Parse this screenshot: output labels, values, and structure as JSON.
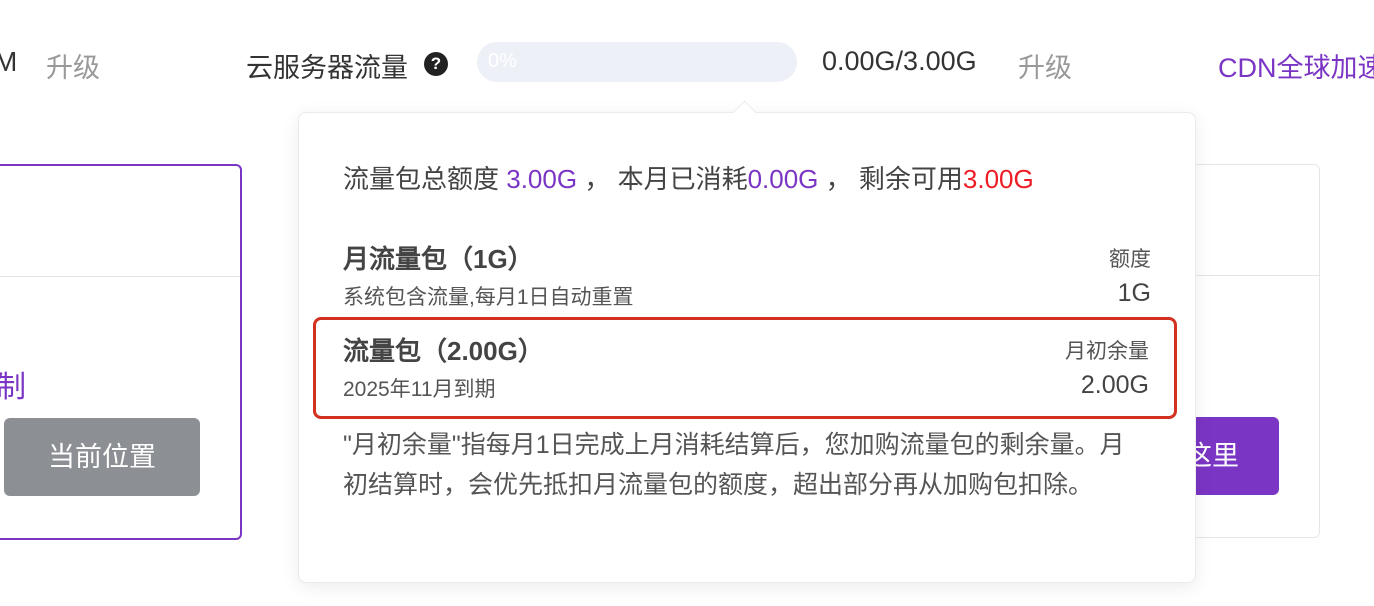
{
  "top_bar": {
    "clipped_left_text": "M",
    "upgrade_label_left": "升级",
    "metric_label": "云服务器流量",
    "help_icon": "question-circle-icon",
    "progress": {
      "percent": 0,
      "text": "0%"
    },
    "usage_value": "0.00G/3.00G",
    "upgrade_label_right": "升级",
    "cdn_link": "CDN全球加速"
  },
  "left_card": {
    "partial_text": "定制",
    "current_button": "当前位置"
  },
  "right_card": {
    "button_label": "这里"
  },
  "popover": {
    "summary": {
      "total_label": "流量包总额度",
      "total_value": "3.00G",
      "sep1": "，",
      "used_label": "本月已消耗",
      "used_value": "0.00G",
      "sep2": "，",
      "remain_label": "剩余可用",
      "remain_value": "3.00G"
    },
    "packages": [
      {
        "name": "月流量包（1G）",
        "desc": "系统包含流量,每月1日自动重置",
        "meta_label": "额度",
        "meta_value": "1G"
      },
      {
        "name": "流量包（2.00G）",
        "desc": "2025年11月到期",
        "meta_label": "月初余量",
        "meta_value": "2.00G"
      }
    ],
    "note": "\"月初余量\"指每月1日完成上月消耗结算后，您加购流量包的剩余量。月初结算时，会优先抵扣月流量包的额度，超出部分再从加购包扣除。"
  },
  "colors": {
    "accent": "#7b35c4",
    "danger": "#ee1c25",
    "highlight_border": "#d2311f",
    "muted": "#999999"
  }
}
